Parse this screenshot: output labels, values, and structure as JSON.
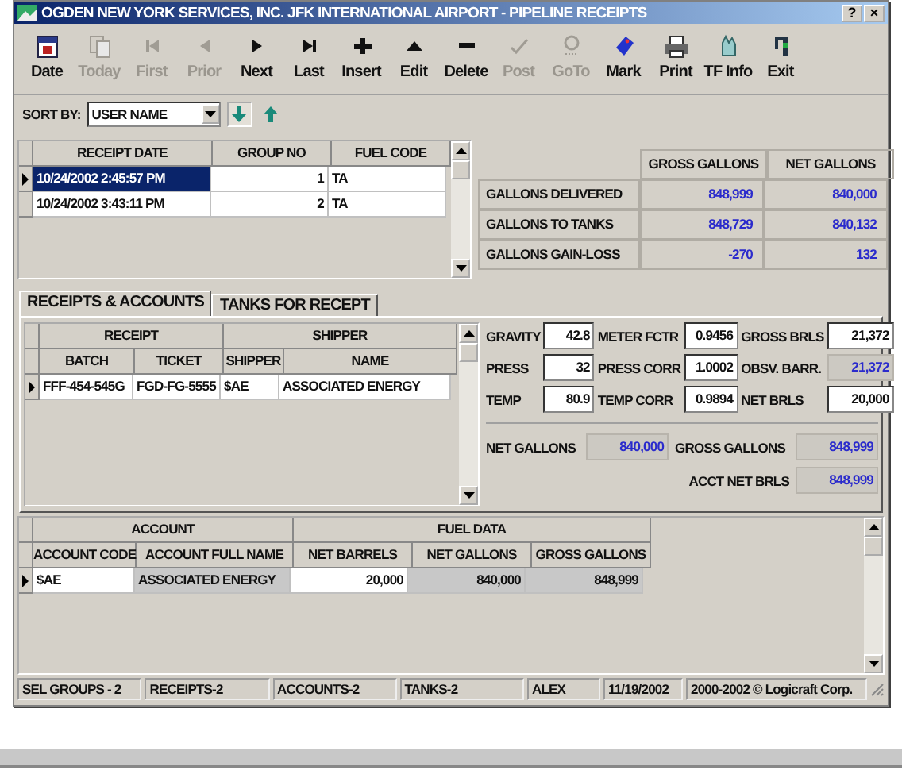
{
  "window": {
    "title": "OGDEN NEW YORK SERVICES, INC. JFK INTERNATIONAL AIRPORT - PIPELINE RECEIPTS",
    "buttons": [
      "?",
      "×"
    ]
  },
  "toolbar": [
    {
      "label": "Date",
      "disabled": false
    },
    {
      "label": "Today",
      "disabled": true
    },
    {
      "label": "First",
      "disabled": true
    },
    {
      "label": "Prior",
      "disabled": true
    },
    {
      "label": "Next",
      "disabled": false
    },
    {
      "label": "Last",
      "disabled": false
    },
    {
      "label": "Insert",
      "disabled": false
    },
    {
      "label": "Edit",
      "disabled": false
    },
    {
      "label": "Delete",
      "disabled": false
    },
    {
      "label": "Post",
      "disabled": true
    },
    {
      "label": "GoTo",
      "disabled": true
    },
    {
      "label": "Mark",
      "disabled": false
    },
    {
      "label": "Print",
      "disabled": false
    },
    {
      "label": "TF Info",
      "disabled": false
    },
    {
      "label": "Exit",
      "disabled": false
    }
  ],
  "sort": {
    "label": "SORT BY:",
    "value": "USER NAME",
    "descending": true
  },
  "receipts": {
    "columns": [
      "RECEIPT DATE",
      "GROUP NO",
      "FUEL CODE"
    ],
    "rows": [
      {
        "selected": true,
        "cells": [
          "10/24/2002 2:45:57 PM",
          "1",
          "TA"
        ]
      },
      {
        "selected": false,
        "cells": [
          "10/24/2002 3:43:11 PM",
          "2",
          "TA"
        ]
      }
    ]
  },
  "summary": {
    "columns": [
      "GROSS GALLONS",
      "NET GALLONS"
    ],
    "rows": [
      {
        "label": "GALLONS DELIVERED",
        "values": [
          "848,999",
          "840,000"
        ]
      },
      {
        "label": "GALLONS TO TANKS",
        "values": [
          "848,729",
          "840,132"
        ]
      },
      {
        "label": "GALLONS GAIN-LOSS",
        "values": [
          "-270",
          "132"
        ]
      }
    ]
  },
  "tabs": [
    {
      "label": "RECEIPTS & ACCOUNTS",
      "selected": true
    },
    {
      "label": "TANKS FOR RECEPT",
      "selected": false
    }
  ],
  "receipt_grid": {
    "groups": [
      {
        "label": "RECEIPT",
        "columns": [
          "BATCH",
          "TICKET"
        ]
      },
      {
        "label": "SHIPPER",
        "columns": [
          "SHIPPER",
          "NAME"
        ]
      }
    ],
    "rows": [
      {
        "current": true,
        "cells": [
          "FFF-454-545G",
          "FGD-FG-5555",
          "$AE",
          "ASSOCIATED ENERGY"
        ]
      }
    ]
  },
  "measurements": [
    {
      "label": "GRAVITY",
      "value": "42.8",
      "readonly": false
    },
    {
      "label": "METER FCTR",
      "value": "0.9456",
      "readonly": false
    },
    {
      "label": "GROSS BRLS",
      "value": "21,372",
      "readonly": false
    },
    {
      "label": "PRESS",
      "value": "32",
      "readonly": false
    },
    {
      "label": "PRESS CORR",
      "value": "1.0002",
      "readonly": false
    },
    {
      "label": "OBSV. BARR.",
      "value": "21,372",
      "readonly": true
    },
    {
      "label": "TEMP",
      "value": "80.9",
      "readonly": false
    },
    {
      "label": "TEMP CORR",
      "value": "0.9894",
      "readonly": false
    },
    {
      "label": "NET BRLS",
      "value": "20,000",
      "readonly": false
    }
  ],
  "totals": [
    {
      "label": "NET GALLONS",
      "value": "840,000",
      "readonly": true
    },
    {
      "label": "GROSS GALLONS",
      "value": "848,999",
      "readonly": true
    },
    {
      "label": "ACCT NET BRLS",
      "value": "848,999",
      "readonly": true
    }
  ],
  "accounts": {
    "groups": [
      {
        "label": "ACCOUNT",
        "columns": [
          {
            "label": "ACCOUNT CODE",
            "readonly": false
          },
          {
            "label": "ACCOUNT FULL NAME",
            "readonly": true
          }
        ]
      },
      {
        "label": "FUEL DATA",
        "columns": [
          {
            "label": "NET BARRELS",
            "readonly": false
          },
          {
            "label": "NET GALLONS",
            "readonly": true
          },
          {
            "label": "GROSS GALLONS",
            "readonly": true
          }
        ]
      }
    ],
    "rows": [
      {
        "current": true,
        "cells": [
          "$AE",
          "ASSOCIATED ENERGY",
          "20,000",
          "840,000",
          "848,999"
        ]
      }
    ]
  },
  "status_bar": [
    "SEL GROUPS - 2",
    "RECEIPTS-2",
    "ACCOUNTS-2",
    "TANKS-2",
    "ALEX",
    "11/19/2002",
    "2000-2002 © Logicraft Corp."
  ]
}
